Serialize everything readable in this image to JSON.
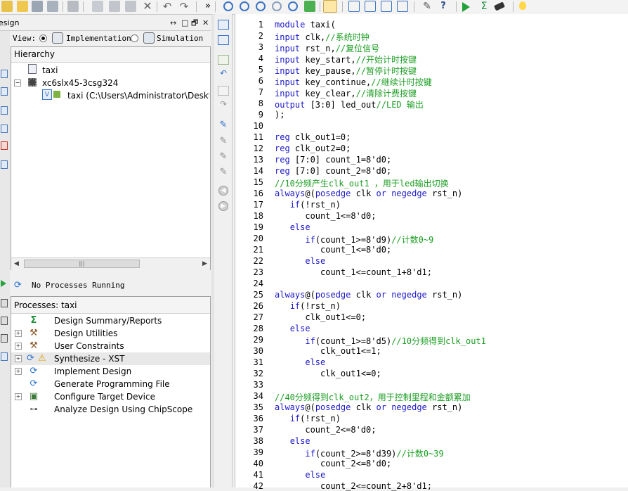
{
  "toolbar": {
    "overflow": "»",
    "icons": [
      "folder-new-icon",
      "open-folder-icon",
      "save-icon",
      "save-all-icon",
      "print-icon",
      "cut-icon",
      "copy-icon",
      "paste-icon",
      "delete-icon",
      "undo-icon",
      "redo-icon",
      "zoom-in-icon",
      "zoom-out-icon",
      "zoom-full-icon",
      "zoom-fit-icon",
      "zoom-back-icon",
      "refresh-icon",
      "select-icon",
      "cascade-icon",
      "tile-horizontal-icon",
      "tile-vertical-icon",
      "restore-icon",
      "properties-icon",
      "help-icon",
      "run-icon",
      "sigma-icon",
      "telescope-icon",
      "lightbulb-icon"
    ]
  },
  "design": {
    "title": "esign",
    "window_controls": [
      "↔",
      "□",
      "🗗",
      "✕"
    ],
    "view_label": "View:",
    "implementation_label": "Implementation",
    "simulation_label": "Simulation",
    "hierarchy_title": "Hierarchy",
    "tree": [
      {
        "label": "taxi",
        "icon": "project-file-icon"
      },
      {
        "label": "xc6slx45-3csg324",
        "icon": "chip-icon"
      },
      {
        "label": "taxi (C:\\Users\\Administrator\\Deskto",
        "icon": "verilog-module-icon"
      }
    ],
    "scroll_grip": "|||",
    "process_status": "No Processes Running",
    "processes_title": "Processes: taxi",
    "processes": [
      {
        "label": "Design Summary/Reports",
        "icon": "sigma-icon",
        "expandable": false
      },
      {
        "label": "Design Utilities",
        "icon": "tools-icon",
        "expandable": true
      },
      {
        "label": "User Constraints",
        "icon": "tools-icon",
        "expandable": true
      },
      {
        "label": "Synthesize - XST",
        "icon": "warning-icon",
        "expandable": true
      },
      {
        "label": "Implement Design",
        "icon": "process-cycle-icon",
        "expandable": true
      },
      {
        "label": "Generate Programming File",
        "icon": "process-cycle-icon",
        "expandable": false
      },
      {
        "label": "Configure Target Device",
        "icon": "device-config-icon",
        "expandable": true
      },
      {
        "label": "Analyze Design Using ChipScope",
        "icon": "chipscope-icon",
        "expandable": false
      }
    ]
  },
  "editor": {
    "lines": [
      {
        "n": "1",
        "parts": [
          [
            "kw",
            "module"
          ],
          [
            "nm",
            " taxi("
          ]
        ]
      },
      {
        "n": "2",
        "parts": [
          [
            "kw",
            "input"
          ],
          [
            "nm",
            " clk,"
          ],
          [
            "cm",
            "//系统时钟"
          ]
        ]
      },
      {
        "n": "3",
        "parts": [
          [
            "kw",
            "input"
          ],
          [
            "nm",
            " rst_n,"
          ],
          [
            "cm",
            "//复位信号"
          ]
        ]
      },
      {
        "n": "4",
        "parts": [
          [
            "kw",
            "input"
          ],
          [
            "nm",
            " key_start,"
          ],
          [
            "cm",
            "//开始计时按键"
          ]
        ]
      },
      {
        "n": "5",
        "parts": [
          [
            "kw",
            "input"
          ],
          [
            "nm",
            " key_pause,"
          ],
          [
            "cm",
            "//暂停计时按键"
          ]
        ]
      },
      {
        "n": "6",
        "parts": [
          [
            "kw",
            "input"
          ],
          [
            "nm",
            " key_continue,"
          ],
          [
            "cm",
            "//继续计时按键"
          ]
        ]
      },
      {
        "n": "7",
        "parts": [
          [
            "kw",
            "input"
          ],
          [
            "nm",
            " key_clear,"
          ],
          [
            "cm",
            "//清除计费按键"
          ]
        ]
      },
      {
        "n": "8",
        "parts": [
          [
            "kw",
            "output"
          ],
          [
            "nm",
            " [3:0] led_out"
          ],
          [
            "cm",
            "//LED 输出"
          ]
        ]
      },
      {
        "n": "9",
        "parts": [
          [
            "nm",
            ");"
          ]
        ]
      },
      {
        "n": "10",
        "parts": []
      },
      {
        "n": "11",
        "parts": [
          [
            "kw",
            "reg"
          ],
          [
            "nm",
            " clk_out1=0;"
          ]
        ]
      },
      {
        "n": "12",
        "parts": [
          [
            "kw",
            "reg"
          ],
          [
            "nm",
            " clk_out2=0;"
          ]
        ]
      },
      {
        "n": "13",
        "parts": [
          [
            "kw",
            "reg"
          ],
          [
            "nm",
            " [7:0] count_1=8'd0;"
          ]
        ]
      },
      {
        "n": "14",
        "parts": [
          [
            "kw",
            "reg"
          ],
          [
            "nm",
            " [7:0] count_2=8'd0;"
          ]
        ]
      },
      {
        "n": "15",
        "parts": [
          [
            "cm",
            "//10分频产生clk_out1 ，用于led输出切换"
          ]
        ]
      },
      {
        "n": "16",
        "parts": [
          [
            "kw",
            "always"
          ],
          [
            "nm",
            "@("
          ],
          [
            "kw",
            "posedge"
          ],
          [
            "nm",
            " clk "
          ],
          [
            "kw",
            "or"
          ],
          [
            "nm",
            " "
          ],
          [
            "kw",
            "negedge"
          ],
          [
            "nm",
            " rst_n)"
          ]
        ]
      },
      {
        "n": "17",
        "parts": [
          [
            "nm",
            "   "
          ],
          [
            "kw",
            "if"
          ],
          [
            "nm",
            "(!rst_n)"
          ]
        ]
      },
      {
        "n": "18",
        "parts": [
          [
            "nm",
            "      count_1<=8'd0;"
          ]
        ]
      },
      {
        "n": "19",
        "parts": [
          [
            "nm",
            "   "
          ],
          [
            "kw",
            "else"
          ]
        ]
      },
      {
        "n": "20",
        "parts": [
          [
            "nm",
            "      "
          ],
          [
            "kw",
            "if"
          ],
          [
            "nm",
            "(count_1>=8'd9)"
          ],
          [
            "cm",
            "//计数0~9"
          ]
        ]
      },
      {
        "n": "21",
        "parts": [
          [
            "nm",
            "         count_1<=8'd0;"
          ]
        ]
      },
      {
        "n": "22",
        "parts": [
          [
            "nm",
            "      "
          ],
          [
            "kw",
            "else"
          ]
        ]
      },
      {
        "n": "23",
        "parts": [
          [
            "nm",
            "         count_1<=count_1+8'd1;"
          ]
        ]
      },
      {
        "n": "24",
        "parts": []
      },
      {
        "n": "25",
        "parts": [
          [
            "kw",
            "always"
          ],
          [
            "nm",
            "@("
          ],
          [
            "kw",
            "posedge"
          ],
          [
            "nm",
            " clk "
          ],
          [
            "kw",
            "or"
          ],
          [
            "nm",
            " "
          ],
          [
            "kw",
            "negedge"
          ],
          [
            "nm",
            " rst_n)"
          ]
        ]
      },
      {
        "n": "26",
        "parts": [
          [
            "nm",
            "   "
          ],
          [
            "kw",
            "if"
          ],
          [
            "nm",
            "(!rst_n)"
          ]
        ]
      },
      {
        "n": "27",
        "parts": [
          [
            "nm",
            "      clk_out1<=0;"
          ]
        ]
      },
      {
        "n": "28",
        "parts": [
          [
            "nm",
            "   "
          ],
          [
            "kw",
            "else"
          ]
        ]
      },
      {
        "n": "29",
        "parts": [
          [
            "nm",
            "      "
          ],
          [
            "kw",
            "if"
          ],
          [
            "nm",
            "(count_1>=8'd5)"
          ],
          [
            "cm",
            "//10分频得到clk_out1"
          ]
        ]
      },
      {
        "n": "30",
        "parts": [
          [
            "nm",
            "         clk_out1<=1;"
          ]
        ]
      },
      {
        "n": "31",
        "parts": [
          [
            "nm",
            "      "
          ],
          [
            "kw",
            "else"
          ]
        ]
      },
      {
        "n": "32",
        "parts": [
          [
            "nm",
            "         clk_out1<=0;"
          ]
        ]
      },
      {
        "n": "33",
        "parts": []
      },
      {
        "n": "34",
        "parts": [
          [
            "cm",
            "//40分频得到clk_out2，用于控制里程和金额累加"
          ]
        ]
      },
      {
        "n": "35",
        "parts": [
          [
            "kw",
            "always"
          ],
          [
            "nm",
            "@("
          ],
          [
            "kw",
            "posedge"
          ],
          [
            "nm",
            " clk "
          ],
          [
            "kw",
            "or"
          ],
          [
            "nm",
            " "
          ],
          [
            "kw",
            "negedge"
          ],
          [
            "nm",
            " rst_n)"
          ]
        ]
      },
      {
        "n": "36",
        "parts": [
          [
            "nm",
            "   "
          ],
          [
            "kw",
            "if"
          ],
          [
            "nm",
            "(!rst_n)"
          ]
        ]
      },
      {
        "n": "37",
        "parts": [
          [
            "nm",
            "      count_2<=8'd0;"
          ]
        ]
      },
      {
        "n": "38",
        "parts": [
          [
            "nm",
            "   "
          ],
          [
            "kw",
            "else"
          ]
        ]
      },
      {
        "n": "39",
        "parts": [
          [
            "nm",
            "      "
          ],
          [
            "kw",
            "if"
          ],
          [
            "nm",
            "(count_2>=8'd39)"
          ],
          [
            "cm",
            "//计数0~39"
          ]
        ]
      },
      {
        "n": "40",
        "parts": [
          [
            "nm",
            "         count_2<=8'd0;"
          ]
        ]
      },
      {
        "n": "41",
        "parts": [
          [
            "nm",
            "      "
          ],
          [
            "kw",
            "else"
          ]
        ]
      },
      {
        "n": "42",
        "parts": [
          [
            "nm",
            "         count_2<=count_2+8'd1;"
          ]
        ]
      }
    ]
  },
  "colors": {
    "keyword": "#1b18c9",
    "comment": "#1b9e22",
    "accent": "#2a6fcf"
  }
}
